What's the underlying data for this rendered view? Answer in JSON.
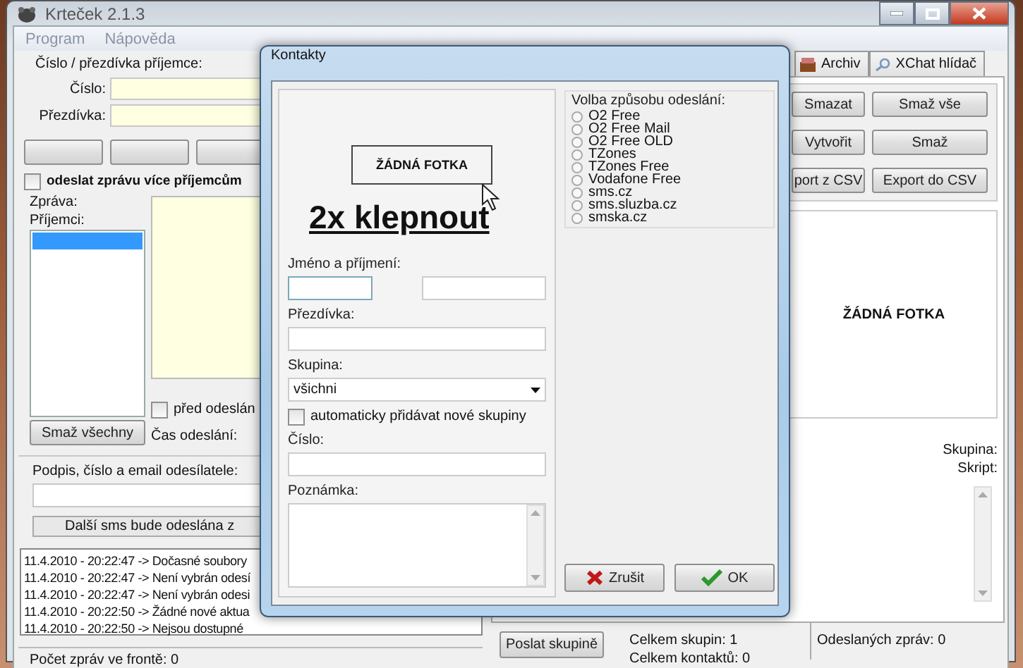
{
  "main_window": {
    "title": "Krteček 2.1.3",
    "menu": [
      "Program",
      "Nápověda"
    ]
  },
  "recipient": {
    "heading": "Číslo / přezdívka příjemce:",
    "number_label": "Číslo:",
    "nickname_label": "Přezdívka:"
  },
  "multi_send": {
    "label": "odeslat zprávu více příjemcům",
    "checked": false
  },
  "message_label": "Zpráva:",
  "recipients_label": "Příjemci:",
  "schedule": {
    "label": "před odeslán",
    "checked": false,
    "time_label": "Čas odeslání:"
  },
  "clear_all_button": "Smaž všechny",
  "sender_label": "Podpis, číslo a email odesílatele:",
  "next_sms": "Další sms bude odeslána z",
  "log": [
    "11.4.2010 - 20:22:47 -> Dočasné soubory",
    "11.4.2010 - 20:22:47 -> Není vybrán odesí",
    "11.4.2010 - 20:22:47 -> Není vybrán odesi",
    "11.4.2010 - 20:22:50 -> Žádné nové aktua",
    "11.4.2010 - 20:22:50 -> Nejsou dostupné"
  ],
  "status": "Počet zpráv ve frontě: 0",
  "tabs": [
    {
      "label": "Archiv",
      "selected": false
    },
    {
      "label": "XChat hlídač",
      "selected": false
    }
  ],
  "contact_buttons": [
    [
      "Smazat",
      "Smaž vše"
    ],
    [
      "Vytvořit",
      "Smaž"
    ],
    [
      "port z CSV",
      "Export do CSV"
    ]
  ],
  "photo_text": "ŽÁDNÁ FOTKA",
  "details": {
    "group_label": "Skupina:",
    "script_label": "Skript:"
  },
  "send_group_button": "Poslat skupině",
  "stats": [
    "Celkem skupin: 1",
    "Celkem kontaktů: 0"
  ],
  "sent": "Odeslaných zpráv: 0",
  "dialog": {
    "title": "Kontakty",
    "photo_text": "ŽÁDNÁ FOTKA",
    "hint": "2x klepnout",
    "name_label": "Jméno a příjmení:",
    "nickname_label": "Přezdívka:",
    "group_label": "Skupina:",
    "group_value": "všichni",
    "auto_groups": {
      "label": "automaticky přidávat nové skupiny",
      "checked": false
    },
    "number_label": "Číslo:",
    "note_label": "Poznámka:",
    "method_label": "Volba způsobu odeslání:",
    "methods": [
      {
        "label": "O2 Free",
        "selected": false
      },
      {
        "label": "O2 Free Mail",
        "selected": false
      },
      {
        "label": "O2 Free OLD",
        "selected": false
      },
      {
        "label": "TZones",
        "selected": false
      },
      {
        "label": "TZones Free",
        "selected": false
      },
      {
        "label": "Vodafone Free",
        "selected": false
      },
      {
        "label": "sms.cz",
        "selected": false
      },
      {
        "label": "sms.sluzba.cz",
        "selected": false
      },
      {
        "label": "smska.cz",
        "selected": false
      }
    ],
    "cancel": "Zrušit",
    "ok": "OK"
  }
}
